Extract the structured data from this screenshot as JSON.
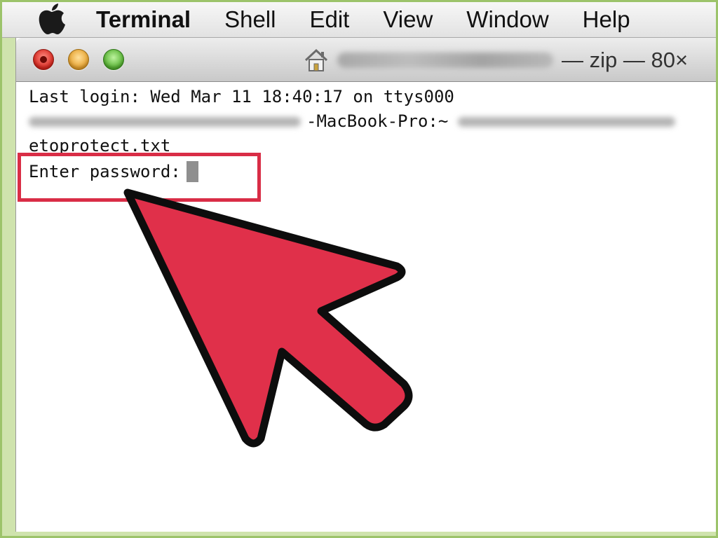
{
  "menubar": {
    "app_name": "Terminal",
    "items": [
      "Shell",
      "Edit",
      "View",
      "Window",
      "Help"
    ]
  },
  "window": {
    "title_suffix": "— zip — 80×"
  },
  "terminal": {
    "last_login": "Last login: Wed Mar 11 18:40:17 on ttys000",
    "prompt_host": "-MacBook-Pro:~",
    "file_line": "etoprotect.txt",
    "password_prompt": "Enter password:"
  },
  "colors": {
    "highlight": "#d92d46",
    "arrow_fill": "#e0304a",
    "frame_green": "#9cc36a"
  },
  "icons": {
    "apple": "apple-icon",
    "home": "home-folder-icon",
    "pointer": "pointer-arrow-icon"
  }
}
